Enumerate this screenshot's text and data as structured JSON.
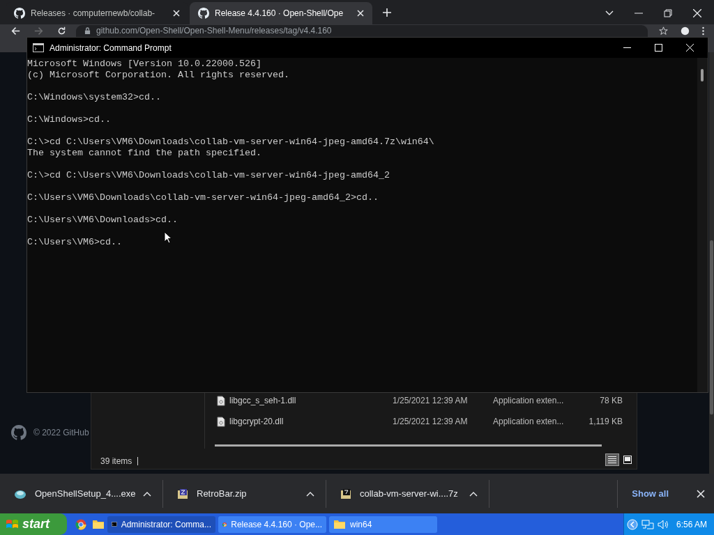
{
  "browser": {
    "tabs": [
      {
        "title": "Releases · computernewb/collab-",
        "selected": false
      },
      {
        "title": "Release 4.4.160 · Open-Shell/Ope",
        "selected": true
      }
    ],
    "address": "github.com/Open-Shell/Open-Shell-Menu/releases/tag/v4.4.160",
    "footer": "© 2022 GitHub"
  },
  "explorer": {
    "files": [
      {
        "name": "libgcc_s_seh-1.dll",
        "date": "1/25/2021 12:39 AM",
        "type": "Application exten...",
        "size": "78 KB"
      },
      {
        "name": "libgcrypt-20.dll",
        "date": "1/25/2021 12:39 AM",
        "type": "Application exten...",
        "size": "1,119 KB"
      }
    ],
    "status": "39 items",
    "view_buttons": [
      {
        "kind": "details",
        "selected": true
      },
      {
        "kind": "tiles",
        "selected": false
      }
    ]
  },
  "cmd": {
    "title": "Administrator: Command Prompt",
    "blocks": [
      [
        "Microsoft Windows [Version 10.0.22000.526]",
        "(c) Microsoft Corporation. All rights reserved."
      ],
      [
        "C:\\Windows\\system32>cd.."
      ],
      [
        "C:\\Windows>cd.."
      ],
      [
        "C:\\>cd C:\\Users\\VM6\\Downloads\\collab-vm-server-win64-jpeg-amd64.7z\\win64\\",
        "The system cannot find the path specified."
      ],
      [
        "C:\\>cd C:\\Users\\VM6\\Downloads\\collab-vm-server-win64-jpeg-amd64_2"
      ],
      [
        "C:\\Users\\VM6\\Downloads\\collab-vm-server-win64-jpeg-amd64_2>cd.."
      ],
      [
        "C:\\Users\\VM6\\Downloads>cd.."
      ],
      [
        "C:\\Users\\VM6>cd.."
      ]
    ]
  },
  "downloads": {
    "items": [
      {
        "name": "OpenShellSetup_4....exe",
        "kind": "setup"
      },
      {
        "name": "RetroBar.zip",
        "kind": "zip"
      },
      {
        "name": "collab-vm-server-wi....7z",
        "kind": "sevenzip"
      }
    ],
    "show_all": "Show all"
  },
  "taskbar": {
    "start": "start",
    "tasks": [
      {
        "title": "Administrator: Comma...",
        "kind": "cmd",
        "selected": true
      },
      {
        "title": "Release 4.4.160 · Ope...",
        "kind": "chrome",
        "selected": false
      },
      {
        "title": "win64",
        "kind": "folder",
        "selected": false
      }
    ],
    "clock": "6:56 AM"
  }
}
